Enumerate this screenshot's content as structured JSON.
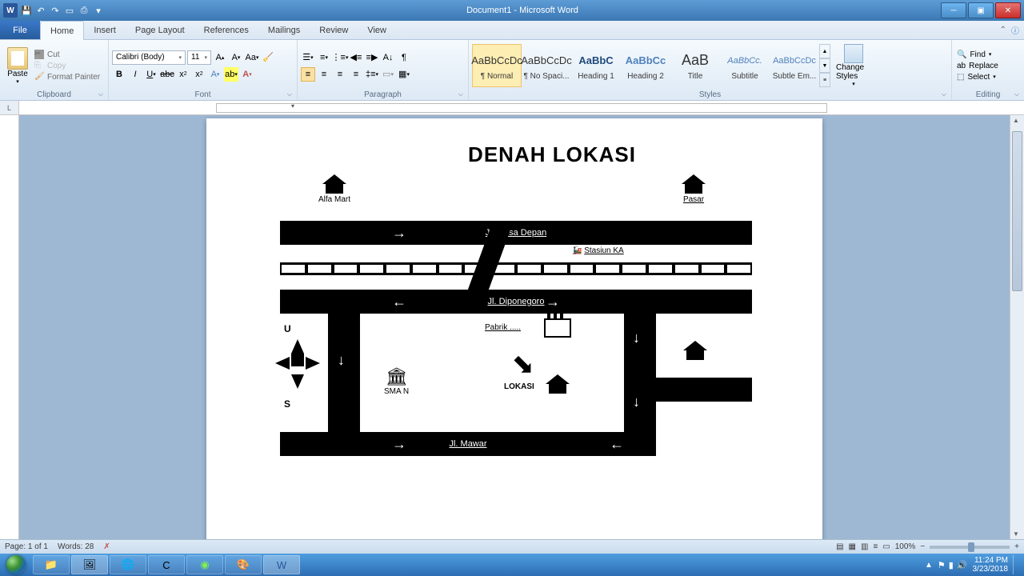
{
  "titlebar": {
    "title": "Document1 - Microsoft Word"
  },
  "tabs": {
    "file": "File",
    "items": [
      "Home",
      "Insert",
      "Page Layout",
      "References",
      "Mailings",
      "Review",
      "View"
    ]
  },
  "clipboard": {
    "paste": "Paste",
    "cut": "Cut",
    "copy": "Copy",
    "format": "Format Painter",
    "label": "Clipboard"
  },
  "font": {
    "name": "Calibri (Body)",
    "size": "11",
    "label": "Font"
  },
  "para": {
    "label": "Paragraph"
  },
  "styles": {
    "label": "Styles",
    "change": "Change Styles",
    "items": [
      {
        "preview": "AaBbCcDc",
        "name": "¶ Normal",
        "cls": "sel"
      },
      {
        "preview": "AaBbCcDc",
        "name": "¶ No Spaci...",
        "cls": ""
      },
      {
        "preview": "AaBbC",
        "name": "Heading 1",
        "cls": "h1"
      },
      {
        "preview": "AaBbCc",
        "name": "Heading 2",
        "cls": "h2"
      },
      {
        "preview": "AaB",
        "name": "Title",
        "cls": "title"
      },
      {
        "preview": "AaBbCc.",
        "name": "Subtitle",
        "cls": "subt"
      },
      {
        "preview": "AaBbCcDc",
        "name": "Subtle Em...",
        "cls": "se"
      }
    ]
  },
  "editing": {
    "find": "Find",
    "replace": "Replace",
    "select": "Select",
    "label": "Editing"
  },
  "map": {
    "title": "DENAH LOKASI",
    "alfamart": "Alfa Mart",
    "pasar": "Pasar",
    "jl1": "Jl. Masa Depan",
    "stasiun": "Stasiun KA",
    "jl2": "Jl. Diponegoro",
    "pabrik": "Pabrik .....",
    "sman": "SMA N",
    "lokasi": "LOKASI",
    "jl3": "Jl. Mawar",
    "compassN": "U",
    "compassS": "S"
  },
  "status": {
    "page": "Page: 1 of 1",
    "words": "Words: 28",
    "zoom": "100%"
  },
  "tray": {
    "time": "11:24 PM",
    "date": "3/23/2018"
  }
}
